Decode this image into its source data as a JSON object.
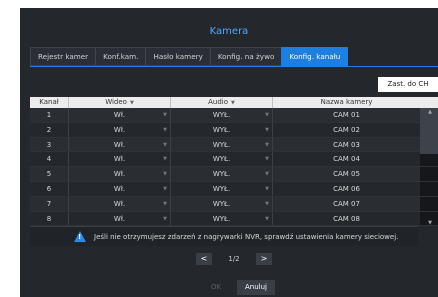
{
  "title": "Kamera",
  "tabs": [
    {
      "label": "Rejestr kamer"
    },
    {
      "label": "Konf.kam."
    },
    {
      "label": "Hasło kamery"
    },
    {
      "label": "Konfig. na żywo"
    },
    {
      "label": "Konfig. kanału"
    }
  ],
  "active_tab": 4,
  "copy_button": "Zast. do CH",
  "table": {
    "headers": {
      "channel": "Kanał",
      "video": "Wideo",
      "audio": "Audio",
      "name": "Nazwa kamery"
    },
    "rows": [
      {
        "ch": "1",
        "video": "Wł.",
        "audio": "WYŁ.",
        "name": "CAM 01"
      },
      {
        "ch": "2",
        "video": "Wł.",
        "audio": "WYŁ.",
        "name": "CAM 02"
      },
      {
        "ch": "3",
        "video": "Wł.",
        "audio": "WYŁ.",
        "name": "CAM 03"
      },
      {
        "ch": "4",
        "video": "Wł.",
        "audio": "WYŁ.",
        "name": "CAM 04"
      },
      {
        "ch": "5",
        "video": "Wł.",
        "audio": "WYŁ.",
        "name": "CAM 05"
      },
      {
        "ch": "6",
        "video": "Wł.",
        "audio": "WYŁ.",
        "name": "CAM 06"
      },
      {
        "ch": "7",
        "video": "Wł.",
        "audio": "WYŁ.",
        "name": "CAM 07"
      },
      {
        "ch": "8",
        "video": "Wł.",
        "audio": "WYŁ.",
        "name": "CAM 08"
      }
    ]
  },
  "warning": "Jeśli nie otrzymujesz zdarzeń z nagrywarki NVR, sprawdź ustawienia kamery sieciowej.",
  "pager": {
    "prev": "<",
    "page": "1/2",
    "next": ">"
  },
  "buttons": {
    "ok": "OK",
    "cancel": "Anuluj"
  },
  "colors": {
    "accent": "#1f7fe0",
    "panel": "#24272c",
    "title": "#4fa8ff"
  }
}
